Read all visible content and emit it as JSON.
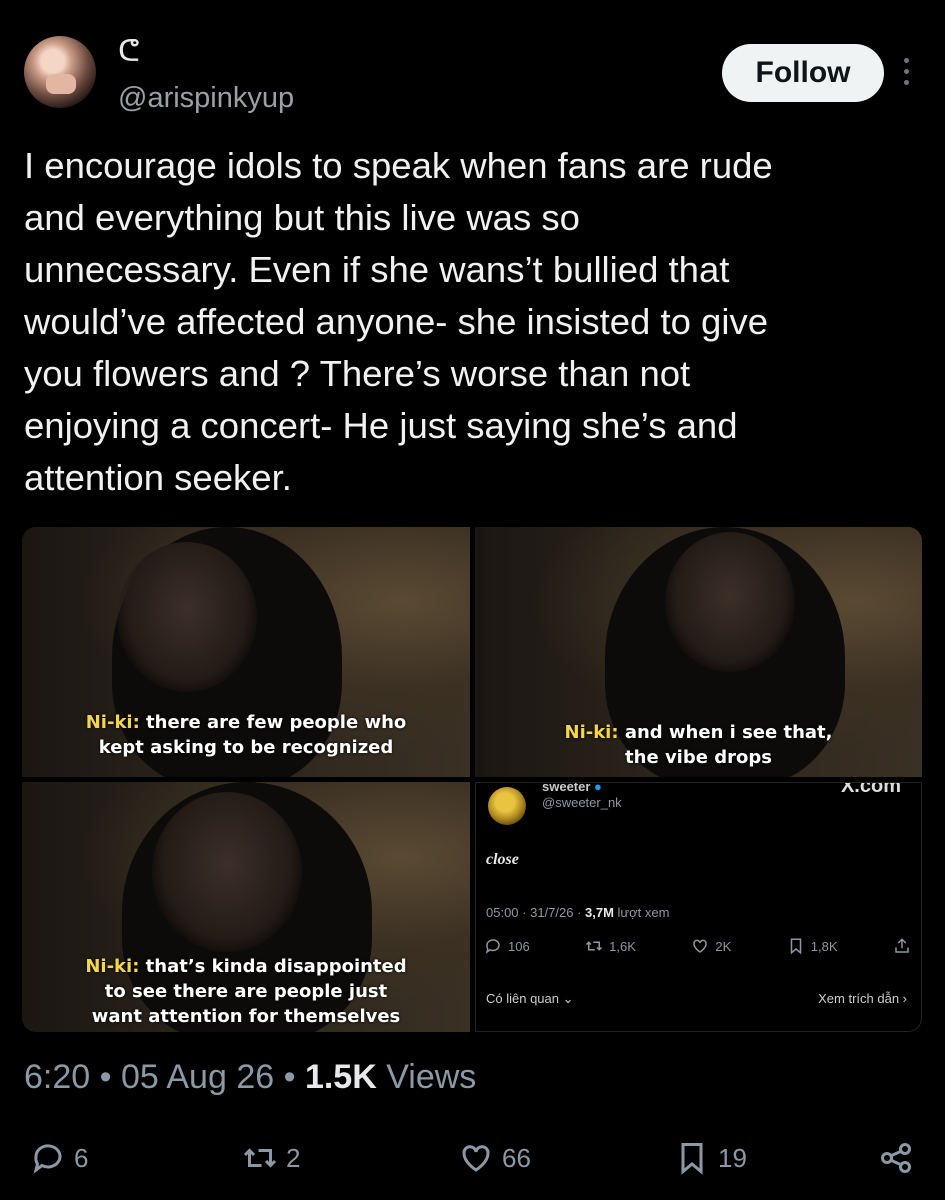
{
  "author": {
    "display_name": "ᕦ",
    "handle": "@arispinkyup",
    "follow_label": "Follow"
  },
  "post": {
    "text": "I encourage idols to speak when fans are rude\nand everything but this live was so\nunnecessary. Even if she wans’t bullied that\nwould’ve affected anyone- she insisted to give\nyou flowers and ? There’s worse than not\nenjoying a concert- He just saying she’s and\nattention seeker."
  },
  "media": {
    "frame1": {
      "speaker": "Ni-ki:",
      "line1": " there are few people who",
      "line2": "kept asking to be recognized"
    },
    "frame2": {
      "speaker": "Ni-ki:",
      "line1": " and when i see that,",
      "line2": "the vibe drops"
    },
    "frame3": {
      "speaker": "Ni-ki:",
      "line1": " that’s kinda disappointed",
      "line2": "to see there are people just",
      "line3": "want attention for themselves"
    },
    "embedded": {
      "name": "sweeter",
      "handle": "@sweeter_nk",
      "source": "X.com",
      "text": "close",
      "meta_prefix": "05:00 · 31/7/26 · ",
      "views_value": "3,7M",
      "views_label": " lượt xem",
      "replies": "106",
      "reposts": "1,6K",
      "likes": "2K",
      "bookmarks": "1,8K",
      "related": "Có liên quan ⌄",
      "quotes": "Xem trích dẫn ›"
    }
  },
  "footer": {
    "time": "6:20",
    "date": "05 Aug 26",
    "views_count": "1.5K",
    "views_label": "Views",
    "replies": "6",
    "reposts": "2",
    "likes": "66",
    "bookmarks": "19"
  },
  "icons": [
    "more-icon",
    "reply-icon",
    "repost-icon",
    "like-icon",
    "bookmark-icon",
    "share-icon",
    "verified-icon"
  ]
}
